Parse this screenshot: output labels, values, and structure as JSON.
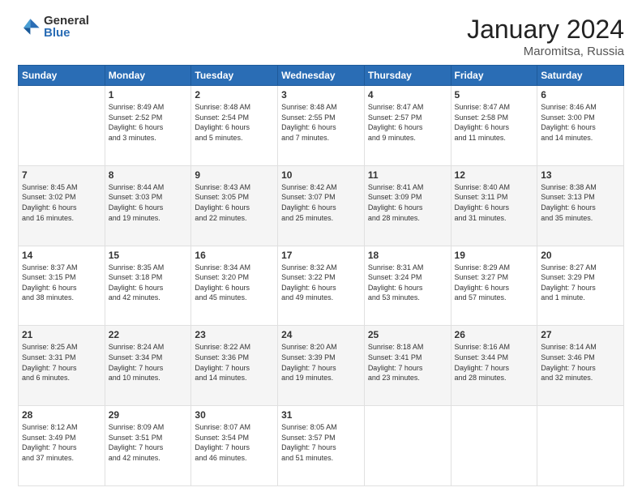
{
  "header": {
    "logo": {
      "general": "General",
      "blue": "Blue"
    },
    "title": "January 2024",
    "location": "Maromitsa, Russia"
  },
  "weekdays": [
    "Sunday",
    "Monday",
    "Tuesday",
    "Wednesday",
    "Thursday",
    "Friday",
    "Saturday"
  ],
  "weeks": [
    [
      {
        "day": "",
        "info": ""
      },
      {
        "day": "1",
        "info": "Sunrise: 8:49 AM\nSunset: 2:52 PM\nDaylight: 6 hours\nand 3 minutes."
      },
      {
        "day": "2",
        "info": "Sunrise: 8:48 AM\nSunset: 2:54 PM\nDaylight: 6 hours\nand 5 minutes."
      },
      {
        "day": "3",
        "info": "Sunrise: 8:48 AM\nSunset: 2:55 PM\nDaylight: 6 hours\nand 7 minutes."
      },
      {
        "day": "4",
        "info": "Sunrise: 8:47 AM\nSunset: 2:57 PM\nDaylight: 6 hours\nand 9 minutes."
      },
      {
        "day": "5",
        "info": "Sunrise: 8:47 AM\nSunset: 2:58 PM\nDaylight: 6 hours\nand 11 minutes."
      },
      {
        "day": "6",
        "info": "Sunrise: 8:46 AM\nSunset: 3:00 PM\nDaylight: 6 hours\nand 14 minutes."
      }
    ],
    [
      {
        "day": "7",
        "info": "Sunrise: 8:45 AM\nSunset: 3:02 PM\nDaylight: 6 hours\nand 16 minutes."
      },
      {
        "day": "8",
        "info": "Sunrise: 8:44 AM\nSunset: 3:03 PM\nDaylight: 6 hours\nand 19 minutes."
      },
      {
        "day": "9",
        "info": "Sunrise: 8:43 AM\nSunset: 3:05 PM\nDaylight: 6 hours\nand 22 minutes."
      },
      {
        "day": "10",
        "info": "Sunrise: 8:42 AM\nSunset: 3:07 PM\nDaylight: 6 hours\nand 25 minutes."
      },
      {
        "day": "11",
        "info": "Sunrise: 8:41 AM\nSunset: 3:09 PM\nDaylight: 6 hours\nand 28 minutes."
      },
      {
        "day": "12",
        "info": "Sunrise: 8:40 AM\nSunset: 3:11 PM\nDaylight: 6 hours\nand 31 minutes."
      },
      {
        "day": "13",
        "info": "Sunrise: 8:38 AM\nSunset: 3:13 PM\nDaylight: 6 hours\nand 35 minutes."
      }
    ],
    [
      {
        "day": "14",
        "info": "Sunrise: 8:37 AM\nSunset: 3:15 PM\nDaylight: 6 hours\nand 38 minutes."
      },
      {
        "day": "15",
        "info": "Sunrise: 8:35 AM\nSunset: 3:18 PM\nDaylight: 6 hours\nand 42 minutes."
      },
      {
        "day": "16",
        "info": "Sunrise: 8:34 AM\nSunset: 3:20 PM\nDaylight: 6 hours\nand 45 minutes."
      },
      {
        "day": "17",
        "info": "Sunrise: 8:32 AM\nSunset: 3:22 PM\nDaylight: 6 hours\nand 49 minutes."
      },
      {
        "day": "18",
        "info": "Sunrise: 8:31 AM\nSunset: 3:24 PM\nDaylight: 6 hours\nand 53 minutes."
      },
      {
        "day": "19",
        "info": "Sunrise: 8:29 AM\nSunset: 3:27 PM\nDaylight: 6 hours\nand 57 minutes."
      },
      {
        "day": "20",
        "info": "Sunrise: 8:27 AM\nSunset: 3:29 PM\nDaylight: 7 hours\nand 1 minute."
      }
    ],
    [
      {
        "day": "21",
        "info": "Sunrise: 8:25 AM\nSunset: 3:31 PM\nDaylight: 7 hours\nand 6 minutes."
      },
      {
        "day": "22",
        "info": "Sunrise: 8:24 AM\nSunset: 3:34 PM\nDaylight: 7 hours\nand 10 minutes."
      },
      {
        "day": "23",
        "info": "Sunrise: 8:22 AM\nSunset: 3:36 PM\nDaylight: 7 hours\nand 14 minutes."
      },
      {
        "day": "24",
        "info": "Sunrise: 8:20 AM\nSunset: 3:39 PM\nDaylight: 7 hours\nand 19 minutes."
      },
      {
        "day": "25",
        "info": "Sunrise: 8:18 AM\nSunset: 3:41 PM\nDaylight: 7 hours\nand 23 minutes."
      },
      {
        "day": "26",
        "info": "Sunrise: 8:16 AM\nSunset: 3:44 PM\nDaylight: 7 hours\nand 28 minutes."
      },
      {
        "day": "27",
        "info": "Sunrise: 8:14 AM\nSunset: 3:46 PM\nDaylight: 7 hours\nand 32 minutes."
      }
    ],
    [
      {
        "day": "28",
        "info": "Sunrise: 8:12 AM\nSunset: 3:49 PM\nDaylight: 7 hours\nand 37 minutes."
      },
      {
        "day": "29",
        "info": "Sunrise: 8:09 AM\nSunset: 3:51 PM\nDaylight: 7 hours\nand 42 minutes."
      },
      {
        "day": "30",
        "info": "Sunrise: 8:07 AM\nSunset: 3:54 PM\nDaylight: 7 hours\nand 46 minutes."
      },
      {
        "day": "31",
        "info": "Sunrise: 8:05 AM\nSunset: 3:57 PM\nDaylight: 7 hours\nand 51 minutes."
      },
      {
        "day": "",
        "info": ""
      },
      {
        "day": "",
        "info": ""
      },
      {
        "day": "",
        "info": ""
      }
    ]
  ]
}
